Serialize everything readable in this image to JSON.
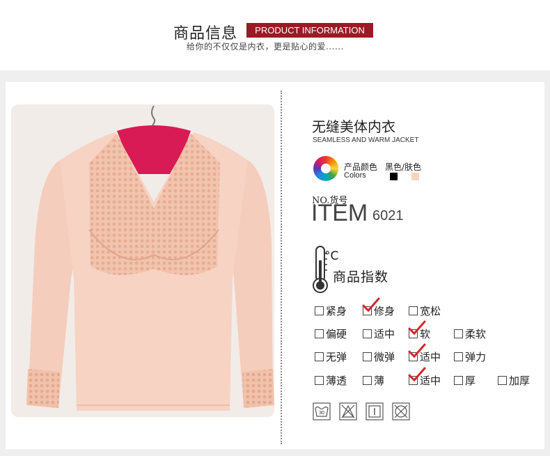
{
  "header": {
    "title_cn": "商品信息",
    "title_en": "PRODUCT INFORMATION",
    "slogan": "给你的不仅仅是内衣，更是贴心的爱......"
  },
  "product": {
    "name_cn": "无缝美体内衣",
    "name_en": "SEAMLESS AND WARM JACKET",
    "colors_label_cn": "产品颜色",
    "colors_label_en": "Colors",
    "colors_value": "黑色/肤色",
    "color_swatches": [
      "#000000",
      "#f3d5c0"
    ],
    "no_label": "NO.货号",
    "item_label": "ITEM",
    "item_number": "6021"
  },
  "index": {
    "unit": "°C",
    "title": "商品指数",
    "rows": [
      {
        "options": [
          {
            "label": "紧身",
            "checked": false
          },
          {
            "label": "修身",
            "checked": true
          },
          {
            "label": "宽松",
            "checked": false
          }
        ]
      },
      {
        "options": [
          {
            "label": "偏硬",
            "checked": false
          },
          {
            "label": "适中",
            "checked": false
          },
          {
            "label": "软",
            "checked": true
          },
          {
            "label": "柔软",
            "checked": false
          }
        ]
      },
      {
        "options": [
          {
            "label": "无弹",
            "checked": false
          },
          {
            "label": "微弹",
            "checked": false
          },
          {
            "label": "适中",
            "checked": true
          },
          {
            "label": "弹力",
            "checked": false
          }
        ]
      },
      {
        "options": [
          {
            "label": "薄透",
            "checked": false
          },
          {
            "label": "薄",
            "checked": false
          },
          {
            "label": "适中",
            "checked": true
          },
          {
            "label": "厚",
            "checked": false
          },
          {
            "label": "加厚",
            "checked": false
          }
        ]
      }
    ]
  },
  "care": {
    "wash_temp": "30",
    "icons": [
      "wash-30-icon",
      "no-bleach-icon",
      "hang-dry-icon",
      "no-tumble-dry-icon"
    ]
  },
  "colors": {
    "accent": "#9a1b25",
    "check": "#d6262b",
    "background_band": "#efefef"
  }
}
